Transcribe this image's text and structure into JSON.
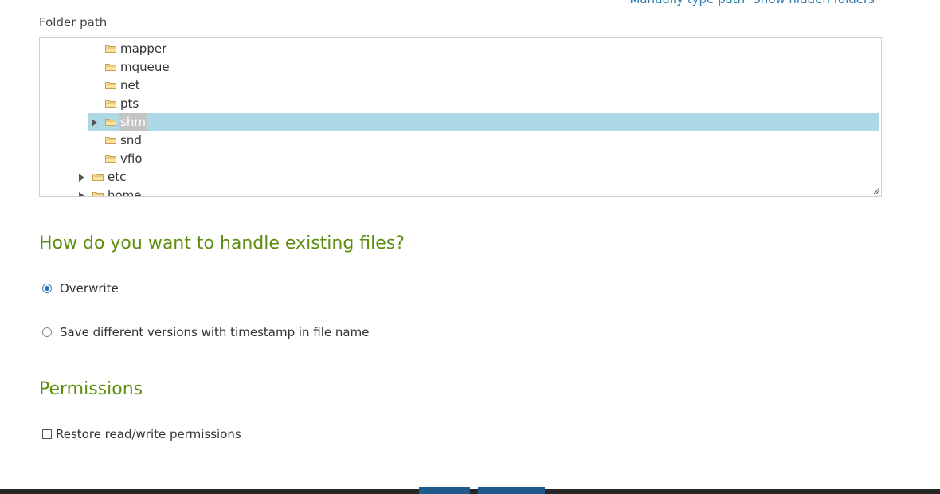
{
  "top_links": {
    "manual_path": "Manually type path",
    "show_hidden": "Show hidden folders"
  },
  "folder_path_label": "Folder path",
  "tree": {
    "items": [
      {
        "name": "mapper",
        "has_children": false,
        "selected": false
      },
      {
        "name": "mqueue",
        "has_children": false,
        "selected": false
      },
      {
        "name": "net",
        "has_children": false,
        "selected": false
      },
      {
        "name": "pts",
        "has_children": false,
        "selected": false
      },
      {
        "name": "shm",
        "has_children": true,
        "selected": true
      },
      {
        "name": "snd",
        "has_children": false,
        "selected": false
      },
      {
        "name": "vfio",
        "has_children": false,
        "selected": false
      },
      {
        "name": "etc",
        "has_children": true,
        "selected": false
      },
      {
        "name": "home",
        "has_children": true,
        "selected": false
      }
    ]
  },
  "existing_files": {
    "title": "How do you want to handle existing files?",
    "options": [
      {
        "label": "Overwrite",
        "checked": true
      },
      {
        "label": "Save different versions with timestamp in file name",
        "checked": false
      }
    ]
  },
  "permissions": {
    "title": "Permissions",
    "restore_label": "Restore read/write permissions",
    "restore_checked": false
  },
  "colors": {
    "accent_green": "#5e8e0e",
    "link_blue": "#2a7ab0",
    "selection_blue": "#add8e6"
  }
}
